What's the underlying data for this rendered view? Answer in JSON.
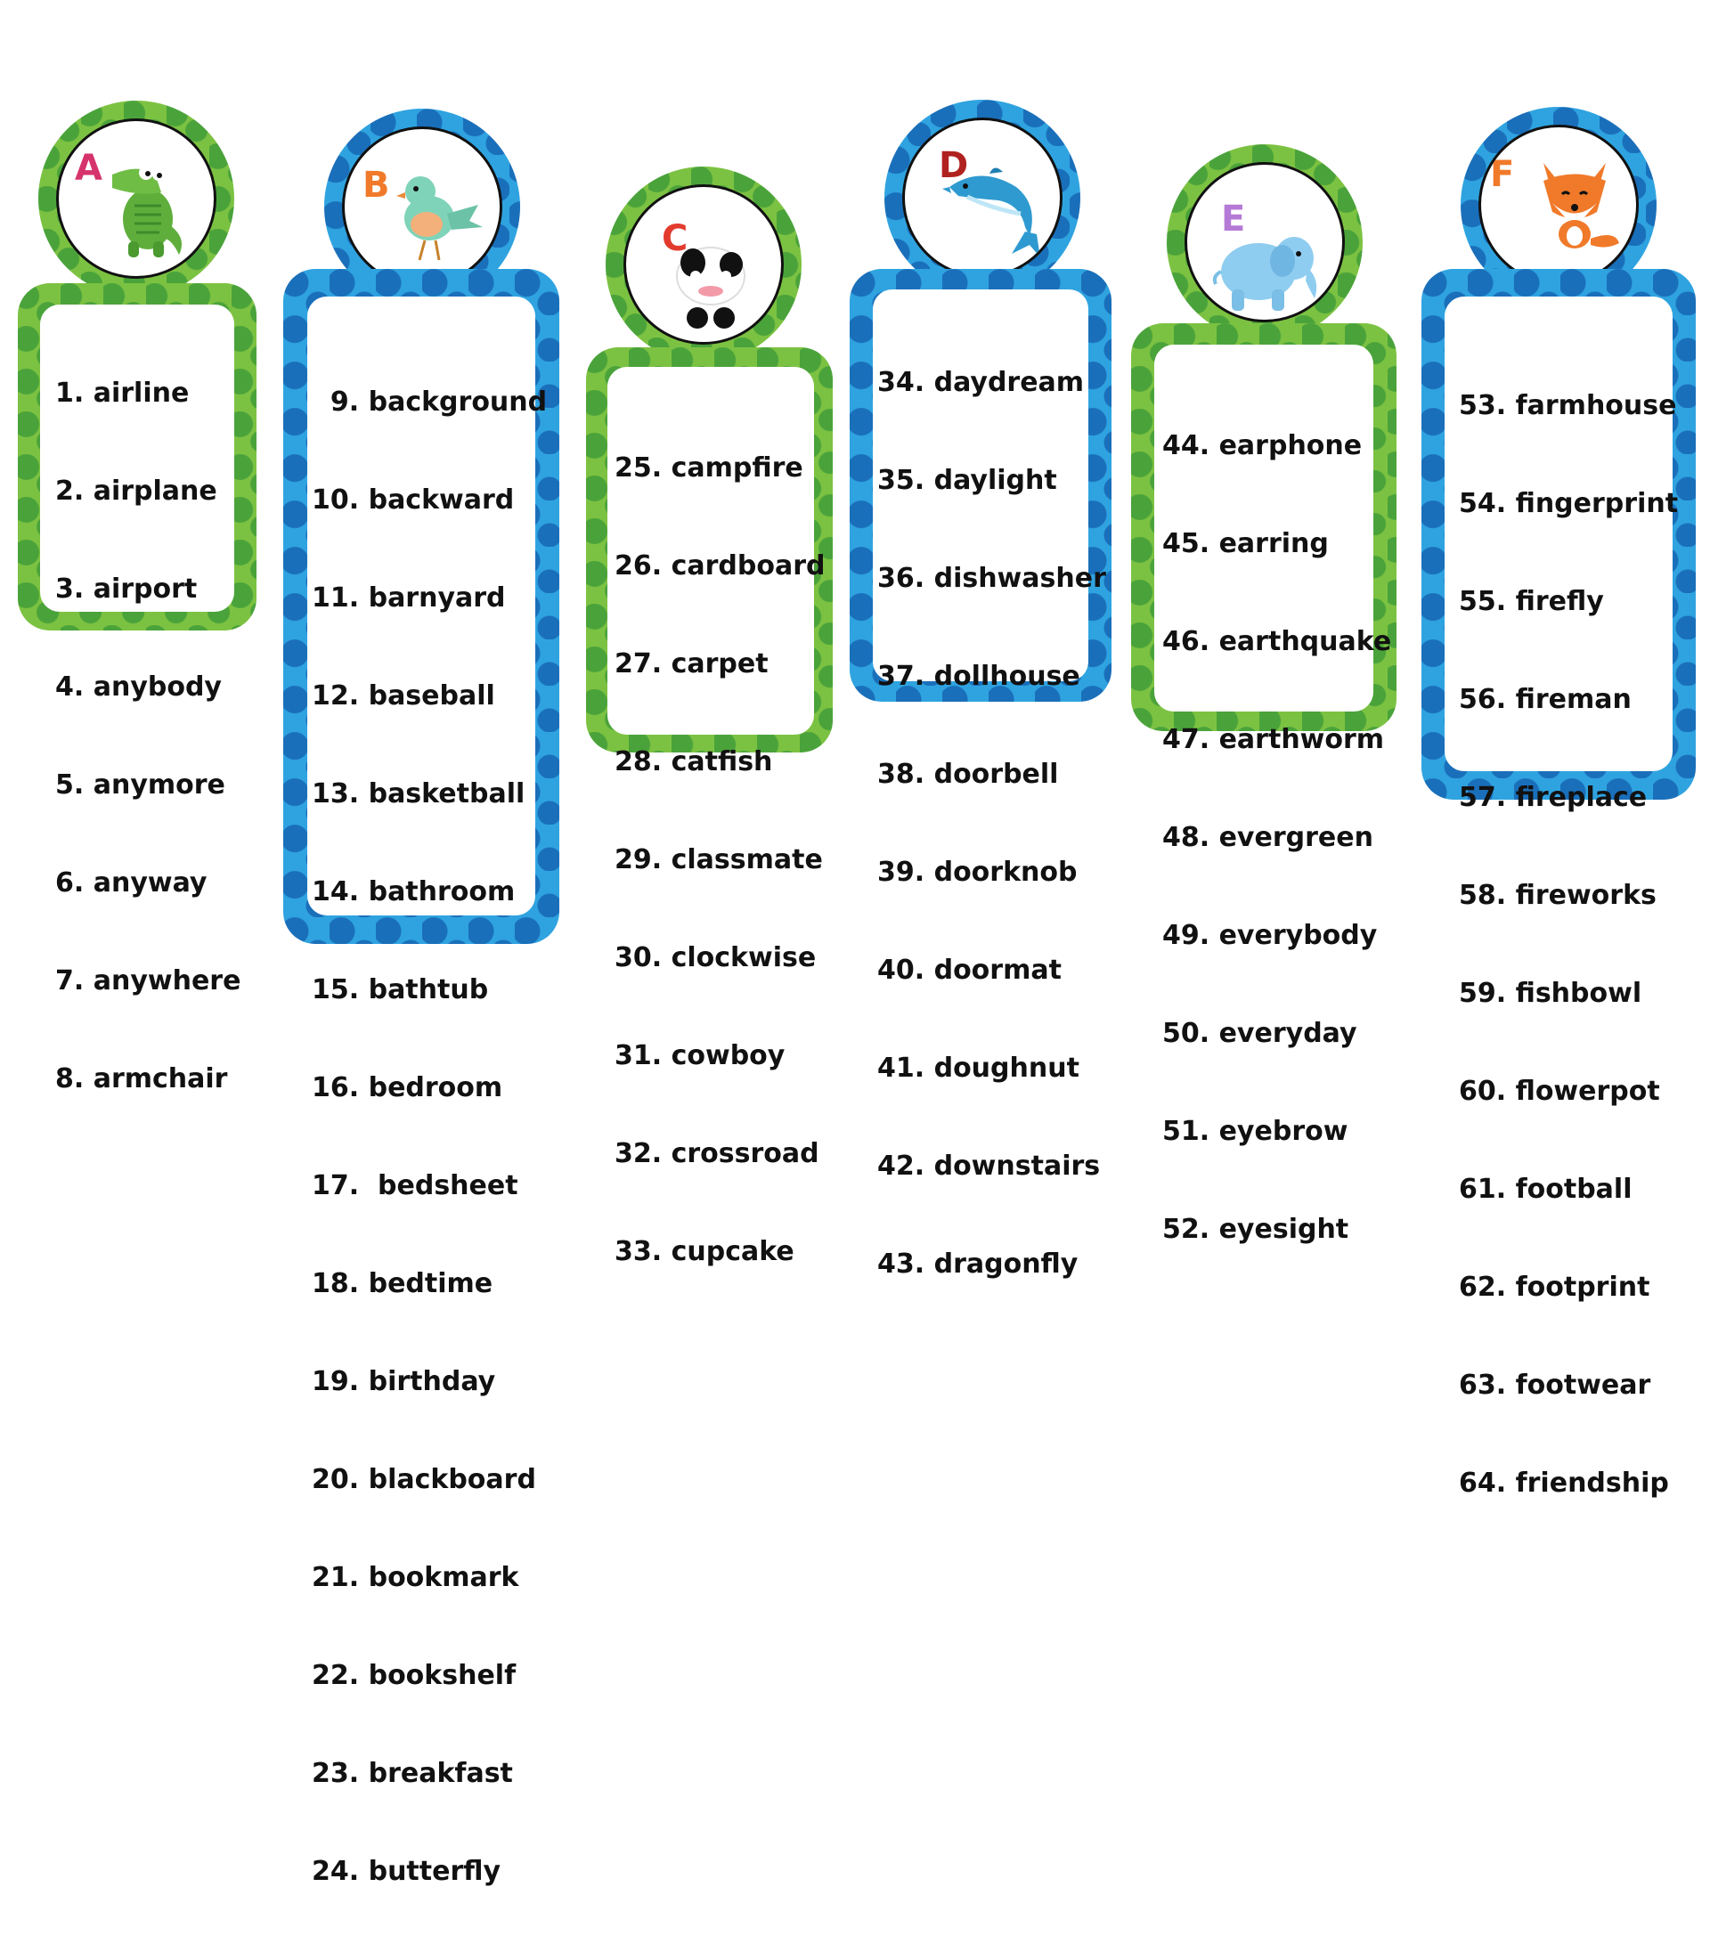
{
  "cards": [
    {
      "letter": "A",
      "letter_color": "#d6336c",
      "animal": "crocodile-icon",
      "items": [
        "1. airline",
        "2. airplane",
        "3. airport",
        "4. anybody",
        "5. anymore",
        "6. anyway",
        "7. anywhere",
        "8. armchair"
      ]
    },
    {
      "letter": "B",
      "letter_color": "#f07a2a",
      "animal": "bird-icon",
      "items": [
        "  9. background",
        "10. backward",
        "11. barnyard",
        "12. baseball",
        "13. basketball",
        "14. bathroom",
        "15. bathtub",
        "16. bedroom",
        "17.  bedsheet",
        "18. bedtime",
        "19. birthday",
        "20. blackboard",
        "21. bookmark",
        "22. bookshelf",
        "23. breakfast",
        "24. butterfly"
      ]
    },
    {
      "letter": "C",
      "letter_color": "#e23b2e",
      "animal": "cow-icon",
      "items": [
        "25. campfire",
        "26. cardboard",
        "27. carpet",
        "28. catfish",
        "29. classmate",
        "30. clockwise",
        "31. cowboy",
        "32. crossroad",
        "33. cupcake"
      ]
    },
    {
      "letter": "D",
      "letter_color": "#b0221f",
      "animal": "dolphin-icon",
      "items": [
        "34. daydream",
        "35. daylight",
        "36. dishwasher",
        "37. dollhouse",
        "38. doorbell",
        "39. doorknob",
        "40. doormat",
        "41. doughnut",
        "42. downstairs",
        "43. dragonfly"
      ]
    },
    {
      "letter": "E",
      "letter_color": "#b57ad6",
      "animal": "elephant-icon",
      "items": [
        "44. earphone",
        "45. earring",
        "46. earthquake",
        "47. earthworm",
        "48. evergreen",
        "49. everybody",
        "50. everyday",
        "51. eyebrow",
        "52. eyesight"
      ]
    },
    {
      "letter": "F",
      "letter_color": "#f07a2a",
      "animal": "fox-icon",
      "items": [
        "53. farmhouse",
        "54. fingerprint",
        "55. firefly",
        "56. fireman",
        "57. fireplace",
        "58. fireworks",
        "59. fishbowl",
        "60. flowerpot",
        "61. football",
        "62. footprint",
        "63. footwear",
        "64. friendship"
      ]
    }
  ]
}
